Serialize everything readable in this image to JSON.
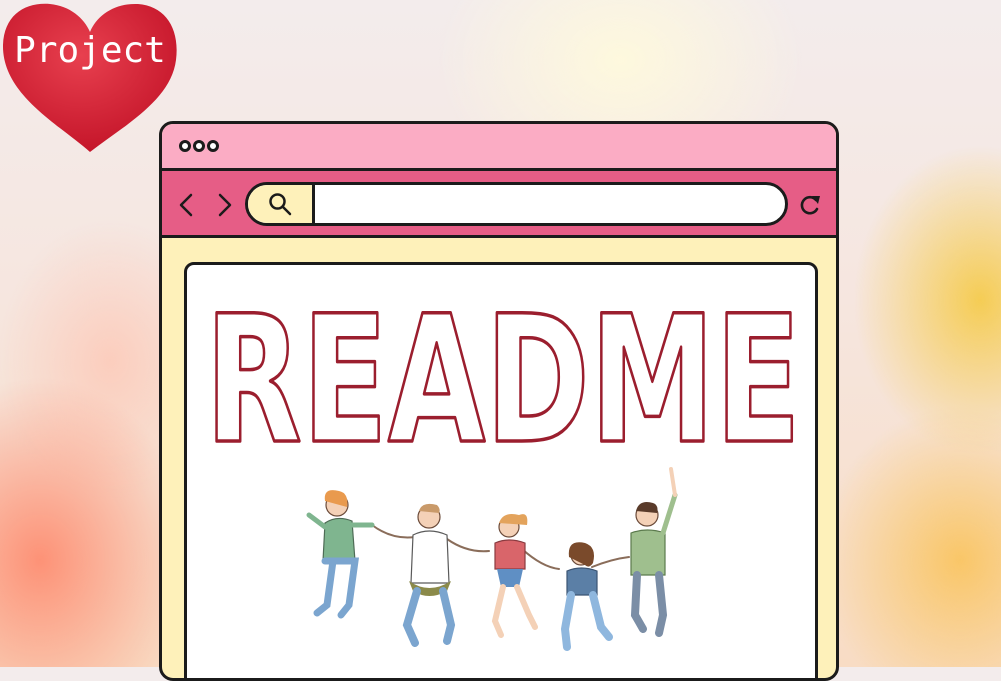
{
  "badge": {
    "label": "Project",
    "color": "#d81f34"
  },
  "browser": {
    "title_bar_color": "#fbacc4",
    "nav_bar_color": "#e65d86",
    "body_color": "#fef1ba",
    "icons": {
      "window_dots": "three-dots-icon",
      "back": "chevron-left-icon",
      "forward": "chevron-right-icon",
      "search": "search-icon",
      "reload": "reload-icon"
    },
    "address": {
      "value": "",
      "placeholder": ""
    }
  },
  "content": {
    "title": "README",
    "title_stroke_color": "#9b1e2e",
    "illustration": "group-of-five-people-jumping-holding-hands"
  }
}
